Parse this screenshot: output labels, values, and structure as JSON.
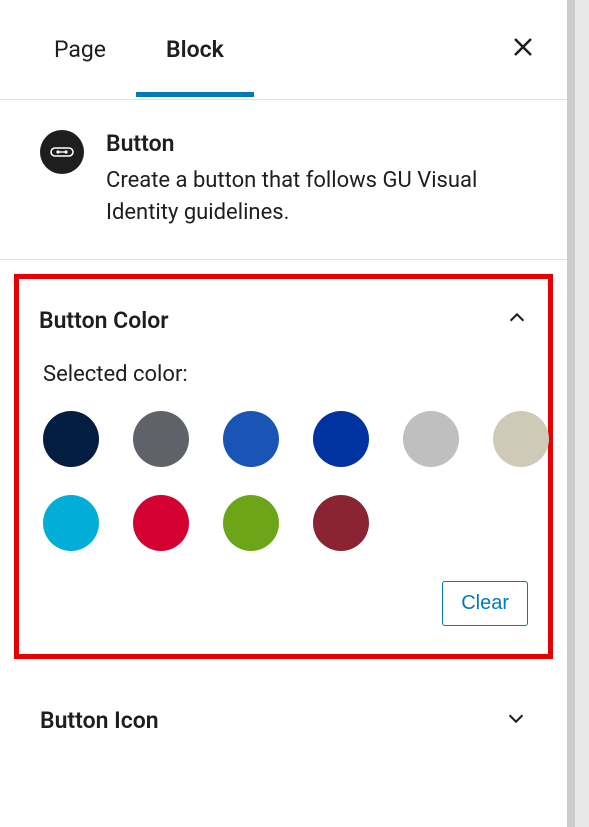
{
  "tabs": {
    "page": "Page",
    "block": "Block"
  },
  "block": {
    "title": "Button",
    "description": "Create a button that follows GU Visual Identity guidelines."
  },
  "colorSection": {
    "title": "Button Color",
    "selectedLabel": "Selected color:",
    "clearLabel": "Clear",
    "swatches": [
      "#041e42",
      "#5f6369",
      "#1a55b5",
      "#0033a0",
      "#bfbfbf",
      "#cfc9b8",
      "#00aed8",
      "#d50032",
      "#6ca518",
      "#8a2432"
    ]
  },
  "iconSection": {
    "title": "Button Icon"
  }
}
